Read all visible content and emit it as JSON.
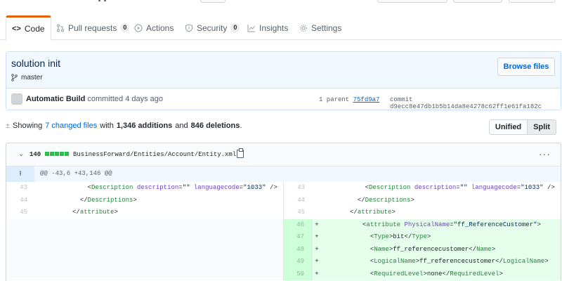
{
  "tabs": [
    {
      "label": "Code",
      "icon": "code-icon",
      "selected": true,
      "count": ""
    },
    {
      "label": "Pull requests",
      "icon": "pull-request-icon",
      "selected": false,
      "count": "0"
    },
    {
      "label": "Actions",
      "icon": "play-icon",
      "selected": false,
      "count": ""
    },
    {
      "label": "Security",
      "icon": "shield-icon",
      "selected": false,
      "count": "0"
    },
    {
      "label": "Insights",
      "icon": "graph-icon",
      "selected": false,
      "count": ""
    },
    {
      "label": "Settings",
      "icon": "gear-icon",
      "selected": false,
      "count": ""
    }
  ],
  "commit": {
    "title": "solution init",
    "branch": "master",
    "browse_label": "Browse files",
    "author": "Automatic Build",
    "action": "committed 4 days ago",
    "parent_label": "1 parent",
    "parent_sha": "75fd9a7",
    "commit_label": "commit",
    "sha": "d9ecc8e47db1b5b14da8e4278c62ff1e61fa182c"
  },
  "toc": {
    "prefix": "Showing",
    "changed": "7 changed files",
    "with": "with",
    "additions": "1,346 additions",
    "and": "and",
    "deletions": "846 deletions",
    "suffix": "."
  },
  "diff_view": {
    "unified": "Unified",
    "split": "Split"
  },
  "file": {
    "count": "140",
    "path": "BusinessForward/Entities/Account/Entity.xml",
    "hunk": "@@ -43,6 +43,146 @@",
    "lines": [
      {
        "left_num": "43",
        "left_pre": "              ",
        "left_code": "<Description description=\"\" languagecode=\"1033\" />",
        "right_num": "43",
        "right_pre": "              ",
        "right_code": "<Description description=\"\" languagecode=\"1033\" />",
        "added": false
      },
      {
        "left_num": "44",
        "left_pre": "            ",
        "left_code": "</Descriptions>",
        "right_num": "44",
        "right_pre": "            ",
        "right_code": "</Descriptions>",
        "added": false
      },
      {
        "left_num": "45",
        "left_pre": "          ",
        "left_code": "</attribute>",
        "right_num": "45",
        "right_pre": "          ",
        "right_code": "</attribute>",
        "added": false
      },
      {
        "left_num": "",
        "left_pre": "",
        "left_code": "",
        "right_num": "46",
        "right_pre": "          ",
        "right_code": "<attribute PhysicalName=\"ff_ReferenceCustomer\">",
        "added": true
      },
      {
        "left_num": "",
        "left_pre": "",
        "left_code": "",
        "right_num": "47",
        "right_pre": "            ",
        "right_code": "<Type>bit</Type>",
        "added": true
      },
      {
        "left_num": "",
        "left_pre": "",
        "left_code": "",
        "right_num": "48",
        "right_pre": "            ",
        "right_code": "<Name>ff_referencecustomer</Name>",
        "added": true
      },
      {
        "left_num": "",
        "left_pre": "",
        "left_code": "",
        "right_num": "49",
        "right_pre": "            ",
        "right_code": "<LogicalName>ff_referencecustomer</LogicalName>",
        "added": true
      },
      {
        "left_num": "",
        "left_pre": "",
        "left_code": "",
        "right_num": "50",
        "right_pre": "            ",
        "right_code": "<RequiredLevel>none</RequiredLevel>",
        "added": true
      }
    ]
  },
  "colors": {
    "accent": "#e36209",
    "link": "#0366d6",
    "added_bg": "#e6ffed",
    "stat_green": "#2cbe4e"
  }
}
